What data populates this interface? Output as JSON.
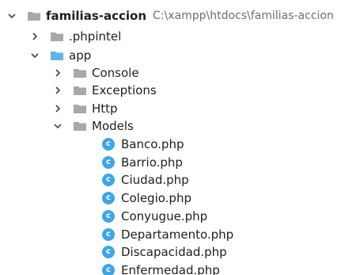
{
  "project": {
    "name": "familias-accion",
    "path": "C:\\xampp\\htdocs\\familias-accion"
  },
  "tree": {
    "phpintel": ".phpintel",
    "app": "app",
    "console": "Console",
    "exceptions": "Exceptions",
    "http": "Http",
    "models": "Models",
    "files": [
      "Banco.php",
      "Barrio.php",
      "Ciudad.php",
      "Colegio.php",
      "Conyugue.php",
      "Departamento.php",
      "Discapacidad.php",
      "Enfermedad.php"
    ],
    "class_icon_letter": "c"
  },
  "colors": {
    "folder_grey": "#a8a8a8",
    "folder_blue": "#61b3e8",
    "class_icon": "#3fa6e6",
    "path_text": "#6e6e6e"
  },
  "icons": {
    "expanded": "chevron-down-icon",
    "collapsed": "chevron-right-icon",
    "folder": "folder-icon",
    "php_class": "php-class-icon"
  }
}
